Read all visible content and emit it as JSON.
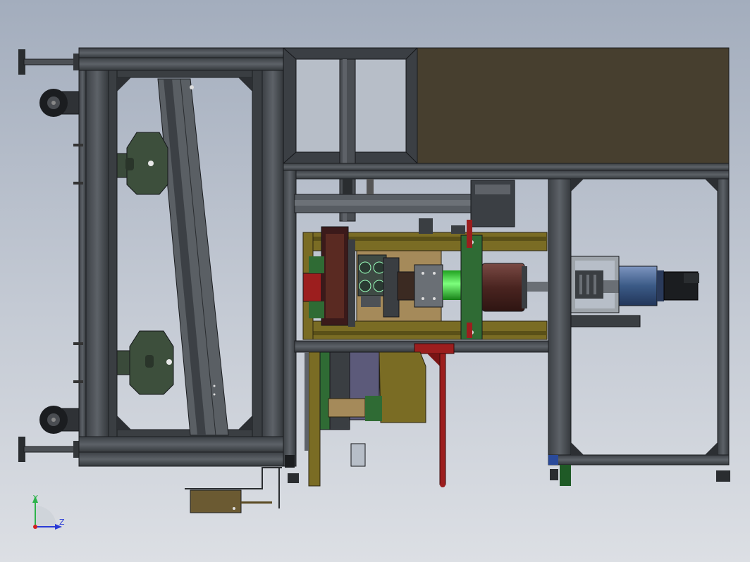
{
  "view": {
    "title": "",
    "background_top": "#a3adbd",
    "background_bottom": "#dcdfe4"
  },
  "triad": {
    "y_label": "Y",
    "z_label": "Z",
    "y_color": "#2db34a",
    "z_color": "#2a3bd6",
    "origin_color": "#d22020"
  },
  "colors": {
    "frame_profile": "#4a4f55",
    "frame_edge": "#22262a",
    "panel_dark": "#473f2f",
    "olive_part": "#8a7a2a",
    "green_part": "#2f6b34",
    "motor_blue": "#3b5a86",
    "red_part": "#9c1e1e",
    "bright_green": "#3ec83e",
    "brown_drum": "#5a2e2a"
  }
}
